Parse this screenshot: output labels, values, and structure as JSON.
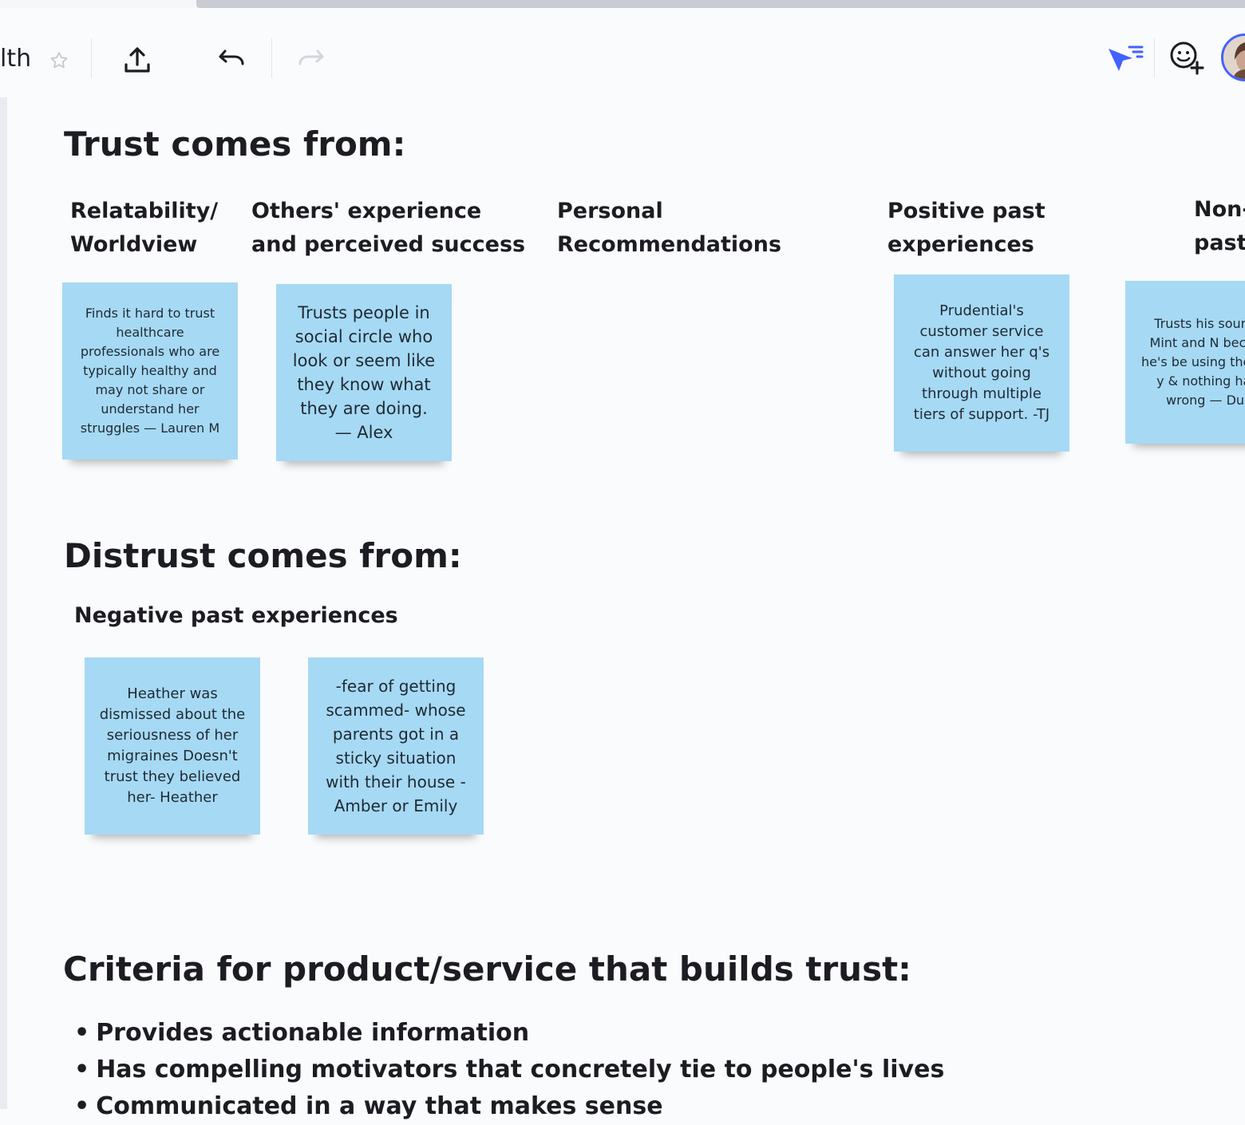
{
  "toolbar": {
    "board_name": "lth",
    "icons": [
      "star-icon",
      "share-upload-icon",
      "undo-icon",
      "redo-icon",
      "cursor-filter-icon",
      "add-reaction-icon",
      "user-avatar"
    ]
  },
  "board": {
    "trust": {
      "heading": "Trust comes from:",
      "columns": [
        {
          "title": "Relatability/\nWorldview",
          "notes": [
            "Finds it hard to trust healthcare professionals who are typically healthy and may not share or understand her struggles — Lauren M"
          ]
        },
        {
          "title": "Others' experience\nand perceived success",
          "notes": [
            "Trusts people in social circle who look or seem like they know what they are doing. — Alex"
          ]
        },
        {
          "title": "Personal\nRecommendations",
          "notes": []
        },
        {
          "title": "Positive past\nexperiences",
          "notes": [
            "Prudential's customer service can answer her q's without going through multiple tiers of support.  -TJ"
          ]
        },
        {
          "title": "Non-\npast",
          "notes": [
            "Trusts his sour like Mint and N because he's be using them for y & nothing has g wrong — Duba"
          ]
        }
      ]
    },
    "distrust": {
      "heading": "Distrust comes from:",
      "columns": [
        {
          "title": "Negative past experiences",
          "notes": [
            "Heather was dismissed about the seriousness of her migraines Doesn't trust they believed her- Heather",
            "-fear of getting scammed- whose parents got in a sticky situation with their house - Amber or Emily"
          ]
        }
      ]
    },
    "criteria": {
      "heading": "Criteria for product/service that builds trust:",
      "bullets": [
        "Provides actionable information",
        "Has compelling motivators that concretely tie to people's lives",
        "Communicated in a way that makes sense"
      ]
    }
  },
  "colors": {
    "sticky": "#a6d9f4",
    "accent": "#4262ff",
    "canvas": "#fafbfc"
  }
}
